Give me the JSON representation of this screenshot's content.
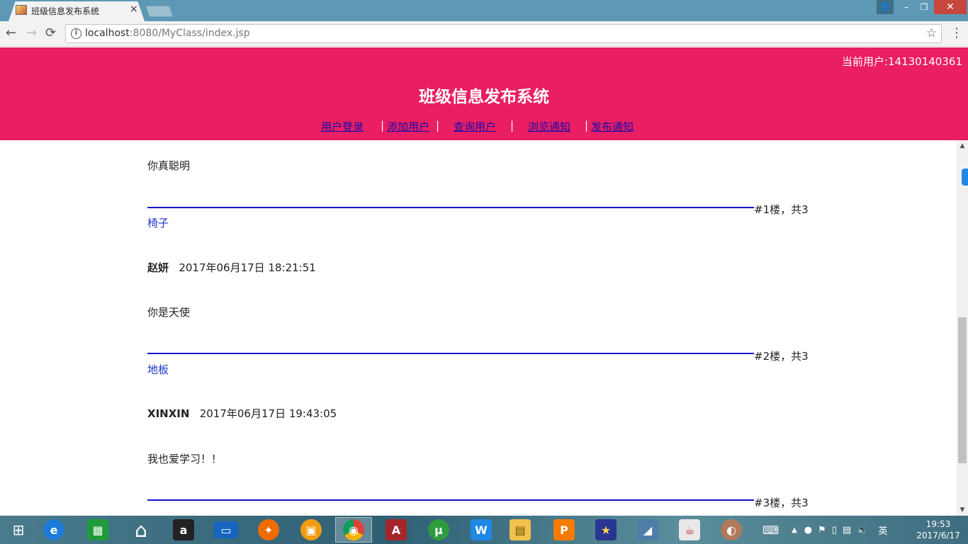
{
  "browser": {
    "tab_title": "班级信息发布系统",
    "tab_close": "×",
    "url_host": "localhost",
    "url_rest": ":8080/MyClass/index.jsp",
    "icons": {
      "back": "←",
      "forward": "→",
      "reload": "⟳",
      "info": "i",
      "star": "☆",
      "menu": "⋮"
    },
    "window_controls": {
      "user": "👤",
      "minimize": "–",
      "maximize": "❐",
      "close": "✕"
    }
  },
  "header": {
    "current_user": "当前用户:14130140361",
    "site_title": "班级信息发布系统",
    "nav": [
      {
        "label": "用户登录"
      },
      {
        "label": "添加用户"
      },
      {
        "label": "查询用户"
      },
      {
        "label": "浏览通知"
      },
      {
        "label": "发布通知"
      }
    ],
    "nav_separator": "|",
    "bg_color": "#e91e63",
    "link_color": "#1a0dab"
  },
  "posts": {
    "first_content": "你真聪明",
    "floors": [
      {
        "floor_label": "#1楼，共3",
        "floor_name": "椅子",
        "author": "赵妍",
        "time": "2017年06月17日 18:21:51",
        "content": "你是天使"
      },
      {
        "floor_label": "#2楼，共3",
        "floor_name": "地板",
        "author": "XINXIN",
        "time": "2017年06月17日 19:43:05",
        "content": "我也爱学习！！"
      },
      {
        "floor_label": "#3楼，共3"
      }
    ]
  },
  "taskbar": {
    "items": [
      {
        "name": "start-icon",
        "glyph": "⊞"
      },
      {
        "name": "internet-explorer-icon",
        "glyph": "e"
      },
      {
        "name": "store-icon",
        "glyph": "▦"
      },
      {
        "name": "home-icon",
        "glyph": "⌂"
      },
      {
        "name": "amazon-icon",
        "glyph": "a"
      },
      {
        "name": "lenovo-icon",
        "glyph": "▭"
      },
      {
        "name": "app-orange-icon",
        "glyph": "✦"
      },
      {
        "name": "app-grid-icon",
        "glyph": "▣"
      },
      {
        "name": "chrome-icon",
        "glyph": "◉"
      },
      {
        "name": "access-icon",
        "glyph": "A"
      },
      {
        "name": "utorrent-icon",
        "glyph": "µ"
      },
      {
        "name": "app-w-icon",
        "glyph": "W"
      },
      {
        "name": "file-explorer-icon",
        "glyph": "▤"
      },
      {
        "name": "presentation-icon",
        "glyph": "P"
      },
      {
        "name": "star-app-icon",
        "glyph": "★"
      },
      {
        "name": "dolphin-icon",
        "glyph": "◢"
      },
      {
        "name": "java-icon",
        "glyph": "☕"
      },
      {
        "name": "photo-icon",
        "glyph": "◐"
      }
    ],
    "ime": "英",
    "time": "19:53",
    "date": "2017/6/17"
  }
}
